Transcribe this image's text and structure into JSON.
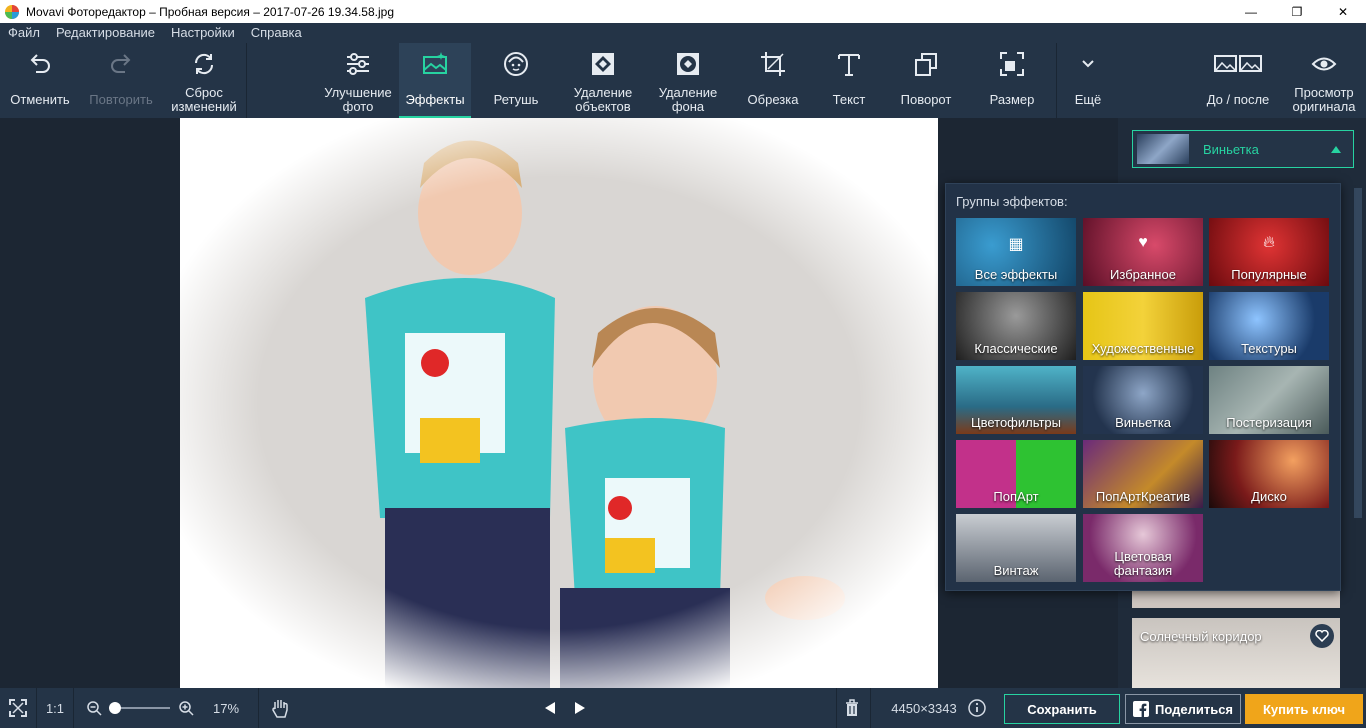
{
  "window": {
    "title": "Movavi Фоторедактор – Пробная версия – 2017-07-26 19.34.58.jpg",
    "minimize": "—",
    "maximize": "❐",
    "close": "✕"
  },
  "menu": [
    "Файл",
    "Редактирование",
    "Настройки",
    "Справка"
  ],
  "toolbar": {
    "undo": "Отменить",
    "redo": "Повторить",
    "reset_line1": "Сброс",
    "reset_line2": "изменений",
    "enhance_line1": "Улучшение",
    "enhance_line2": "фото",
    "effects": "Эффекты",
    "retouch": "Ретушь",
    "remove_obj_line1": "Удаление",
    "remove_obj_line2": "объектов",
    "remove_bg_line1": "Удаление",
    "remove_bg_line2": "фона",
    "crop": "Обрезка",
    "text": "Текст",
    "rotate": "Поворот",
    "resize": "Размер",
    "more": "Ещё",
    "before_after": "До / после",
    "view_orig_line1": "Просмотр",
    "view_orig_line2": "оригинала"
  },
  "right_panel": {
    "selected_effect": "Виньетка",
    "card_title": "Солнечный коридор"
  },
  "effect_groups": {
    "header": "Группы эффектов:",
    "items": [
      {
        "label": "Все эффекты",
        "icon": "grid-icon",
        "color": "#1d5f86"
      },
      {
        "label": "Избранное",
        "icon": "heart-icon",
        "color": "#9a1c3d"
      },
      {
        "label": "Популярные",
        "icon": "flame-icon",
        "color": "#b4181e"
      },
      {
        "label": "Классические",
        "icon": "",
        "color": "#4a4a4a"
      },
      {
        "label": "Художественные",
        "icon": "",
        "color": "#d7b20a"
      },
      {
        "label": "Текстуры",
        "icon": "",
        "color": "#1d3c66"
      },
      {
        "label": "Цветофильтры",
        "icon": "",
        "color": "#2d8aa3"
      },
      {
        "label": "Виньетка",
        "icon": "",
        "color": "#344b6a"
      },
      {
        "label": "Постеризация",
        "icon": "",
        "color": "#7a8f8f"
      },
      {
        "label": "ПопАрт",
        "icon": "",
        "color": "#8d2a6a"
      },
      {
        "label": "ПопАртКреатив",
        "icon": "",
        "color": "#7a2a7a"
      },
      {
        "label": "Диско",
        "icon": "",
        "color": "#b54a1a"
      },
      {
        "label": "Винтаж",
        "icon": "",
        "color": "#5b6470"
      },
      {
        "label": "Цветовая\nфантазия",
        "icon": "",
        "color": "#8e3a78"
      }
    ]
  },
  "bottom": {
    "ratio": "1:1",
    "zoom": "17%",
    "dimensions": "4450×3343",
    "save": "Сохранить",
    "share": "Поделиться",
    "buy": "Купить ключ"
  },
  "colors": {
    "accent": "#27d3a1",
    "buy": "#f0a51a",
    "panel": "#243447"
  }
}
